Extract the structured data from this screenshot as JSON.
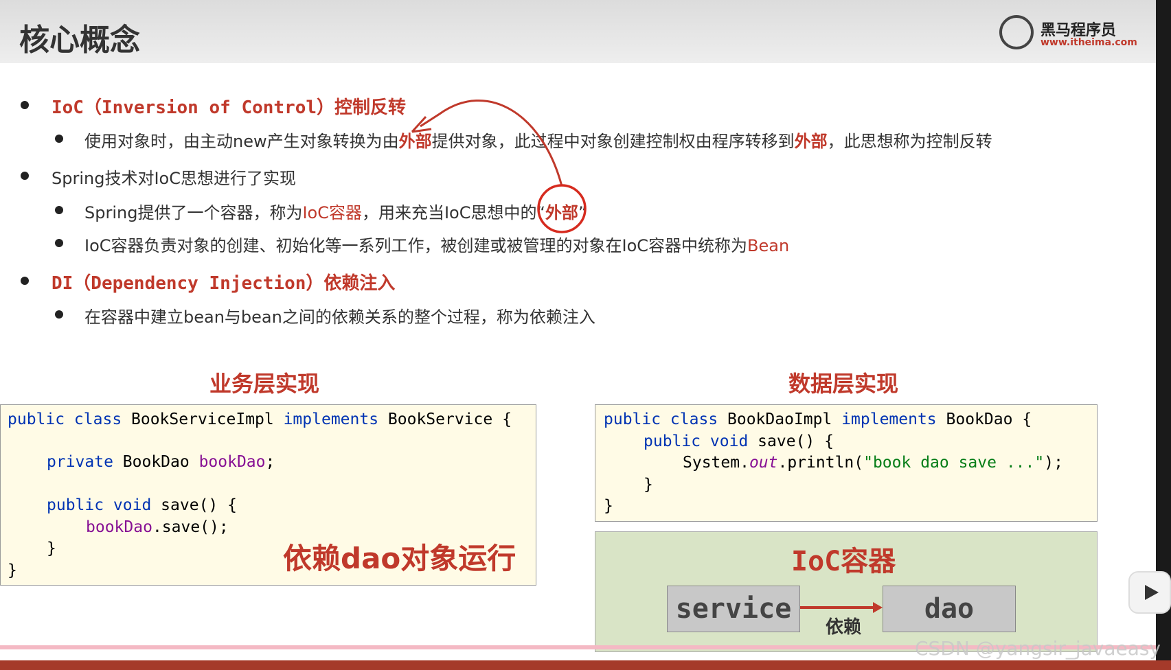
{
  "slide": {
    "title": "核心概念",
    "logo_name": "黑马程序员",
    "logo_url": "www.itheima.com"
  },
  "bullets": {
    "ioc_head_a": "IoC（Inversion of Control）",
    "ioc_head_b": "控制反转",
    "ioc_desc_a": "使用对象时，由主动new产生对象转换为由",
    "ioc_desc_b": "外部",
    "ioc_desc_c": "提供对象，此过程中对象创建控制权由程序转移到",
    "ioc_desc_d": "外部",
    "ioc_desc_e": "，此思想称为控制反转",
    "spring_line": "Spring技术对IoC思想进行了实现",
    "spring_sub1_a": "Spring提供了一个容器，称为",
    "spring_sub1_b": "IoC容器",
    "spring_sub1_c": "，用来充当IoC思想中的“",
    "spring_sub1_d": "外部",
    "spring_sub1_e": "”",
    "spring_sub2_a": "IoC容器负责对象的创建、初始化等一系列工作，被创建或被管理的对象在IoC容器中统称为",
    "spring_sub2_b": "Bean",
    "di_head_a": "DI（Dependency Injection）",
    "di_head_b": "依赖注入",
    "di_desc": "在容器中建立bean与bean之间的依赖关系的整个过程，称为依赖注入"
  },
  "sections": {
    "service_title": "业务层实现",
    "dao_title": "数据层实现"
  },
  "code_service": {
    "l1_kw": "public class",
    "l1_name": " BookServiceImpl ",
    "l1_kw2": "implements",
    "l1_tail": " BookService {",
    "l2_kw": "private",
    "l2_type": " BookDao ",
    "l2_field": "bookDao",
    "l2_tail": ";",
    "l3_kw": "public void",
    "l3_tail": " save() {",
    "l4_field": "bookDao",
    "l4_tail": ".save();",
    "l5": "}",
    "l6": "}"
  },
  "code_dao": {
    "l1_kw": "public class",
    "l1_name": " BookDaoImpl ",
    "l1_kw2": "implements",
    "l1_tail": " BookDao {",
    "l2_kw": "public void",
    "l2_tail": " save() {",
    "l3_a": "System.",
    "l3_b": "out",
    "l3_c": ".println(",
    "l3_str": "\"book dao save ...\"",
    "l3_d": ");",
    "l4": "}",
    "l5": "}"
  },
  "annotation": "依赖dao对象运行",
  "ioc_container": {
    "title": "IoC容器",
    "service": "service",
    "dao": "dao",
    "relation": "依赖"
  },
  "watermark": "CSDN @yangsir_javaeasy",
  "colors": {
    "accent": "#c0392b",
    "code_bg": "#fffbe6",
    "ioc_bg": "#d9e4c6"
  }
}
